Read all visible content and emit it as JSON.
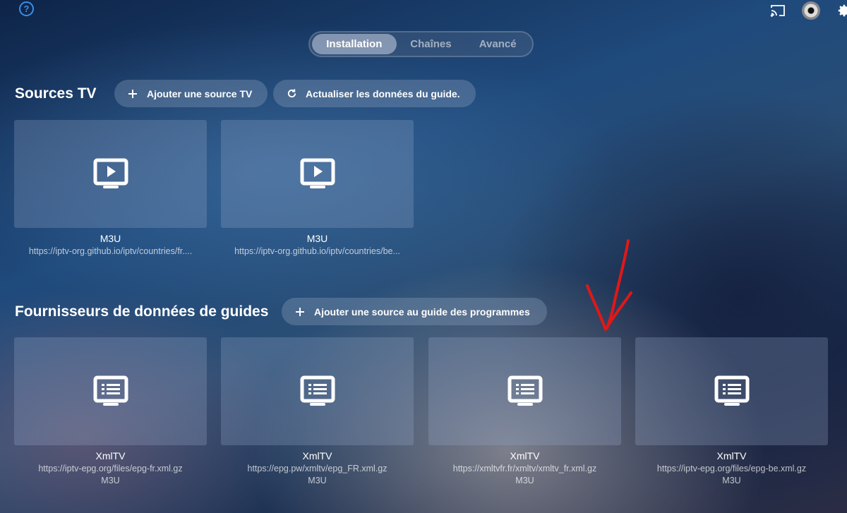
{
  "tabs": [
    {
      "label": "Installation",
      "active": true
    },
    {
      "label": "Chaînes",
      "active": false
    },
    {
      "label": "Avancé",
      "active": false
    }
  ],
  "sources": {
    "title": "Sources TV",
    "add_label": "Ajouter une source TV",
    "refresh_label": "Actualiser les données du guide.",
    "items": [
      {
        "title": "M3U",
        "url": "https://iptv-org.github.io/iptv/countries/fr...."
      },
      {
        "title": "M3U",
        "url": "https://iptv-org.github.io/iptv/countries/be..."
      }
    ]
  },
  "guides": {
    "title": "Fournisseurs de données de guides",
    "add_label": "Ajouter une source au guide des programmes",
    "items": [
      {
        "title": "XmlTV",
        "url": "https://iptv-epg.org/files/epg-fr.xml.gz",
        "type": "M3U"
      },
      {
        "title": "XmlTV",
        "url": "https://epg.pw/xmltv/epg_FR.xml.gz",
        "type": "M3U"
      },
      {
        "title": "XmlTV",
        "url": "https://xmltvfr.fr/xmltv/xmltv_fr.xml.gz",
        "type": "M3U"
      },
      {
        "title": "XmlTV",
        "url": "https://iptv-epg.org/files/epg-be.xml.gz",
        "type": "M3U"
      }
    ]
  },
  "icons": {
    "help": "help-icon",
    "cast": "cast-icon",
    "settings": "gear-icon",
    "source": "tv-play-icon",
    "guide": "tv-list-icon",
    "add": "plus-icon",
    "refresh": "refresh-icon"
  },
  "colors": {
    "help_accent": "#3a8ee6",
    "annotation": "#e01818"
  }
}
